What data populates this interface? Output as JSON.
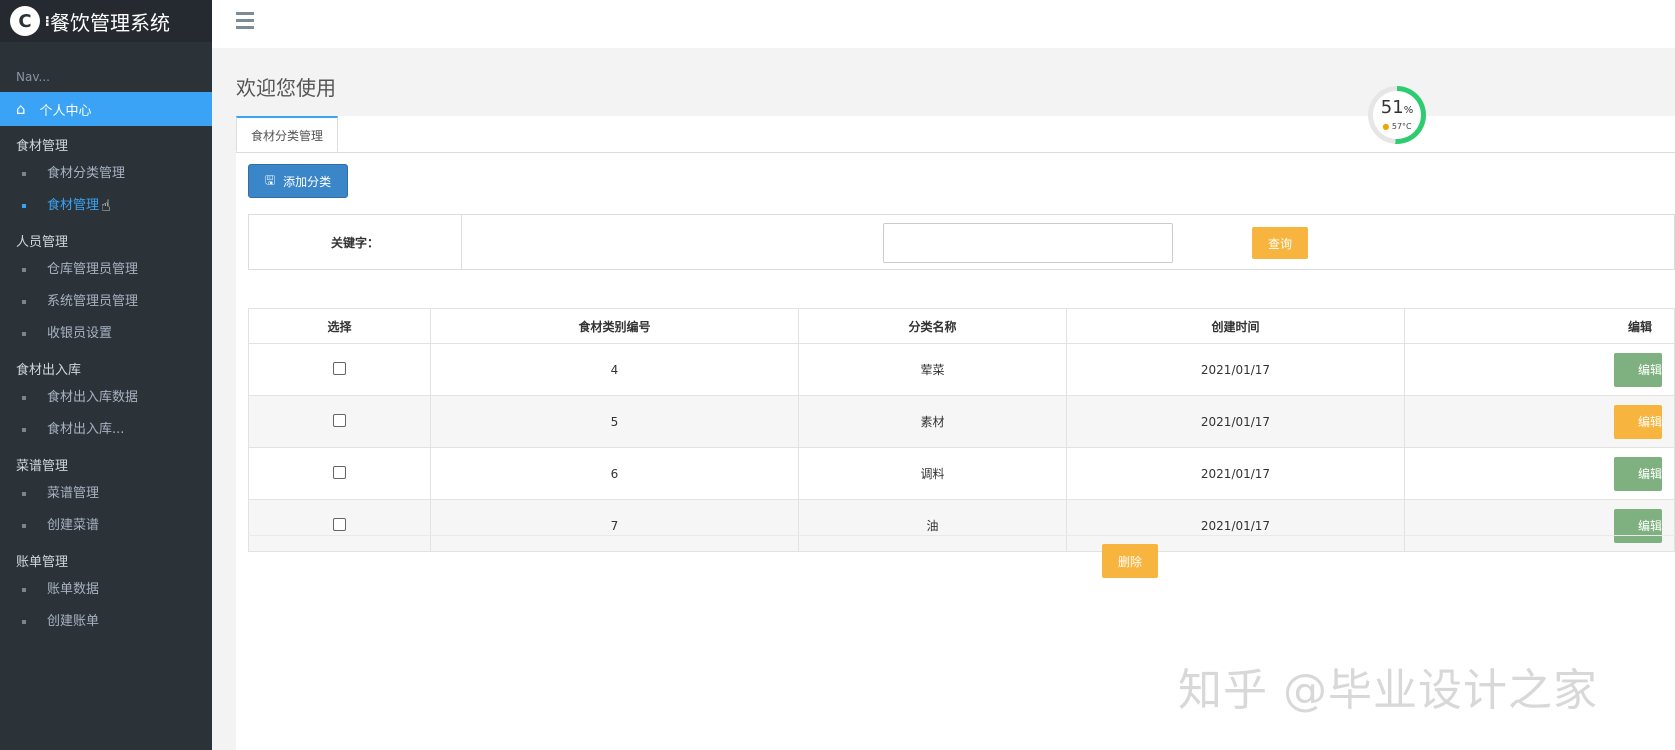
{
  "sidebar": {
    "brand": "餐饮管理系统",
    "nav_header": "Nav...",
    "home": "个人中心",
    "groups": [
      {
        "label": "食材管理",
        "items": [
          "食材分类管理",
          "食材管理"
        ]
      },
      {
        "label": "人员管理",
        "items": [
          "仓库管理员管理",
          "系统管理员管理",
          "收银员设置"
        ]
      },
      {
        "label": "食材出入库",
        "items": [
          "食材出入库数据",
          "食材出入库..."
        ]
      },
      {
        "label": "菜谱管理",
        "items": [
          "菜谱管理",
          "创建菜谱"
        ]
      },
      {
        "label": "账单管理",
        "items": [
          "账单数据",
          "创建账单"
        ]
      }
    ]
  },
  "header": {
    "page_title": "欢迎您使用"
  },
  "tabs": [
    {
      "label": "食材分类管理"
    }
  ],
  "gauge": {
    "value": "51",
    "unit": "%",
    "temp": "57°C"
  },
  "toolbar": {
    "add_label": "添加分类"
  },
  "search": {
    "label": "关键字：",
    "value": "",
    "query_label": "查询"
  },
  "table": {
    "headers": [
      "选择",
      "食材类别编号",
      "分类名称",
      "创建时间",
      "编辑"
    ],
    "rows": [
      {
        "id": "4",
        "name": "荤菜",
        "date": "2021/01/17",
        "edit": "编辑"
      },
      {
        "id": "5",
        "name": "素材",
        "date": "2021/01/17",
        "edit": "编辑"
      },
      {
        "id": "6",
        "name": "调料",
        "date": "2021/01/17",
        "edit": "编辑"
      },
      {
        "id": "7",
        "name": "油",
        "date": "2021/01/17",
        "edit": "编辑"
      }
    ]
  },
  "footer": {
    "delete_label": "删除"
  },
  "watermark": "知乎 @毕业设计之家"
}
